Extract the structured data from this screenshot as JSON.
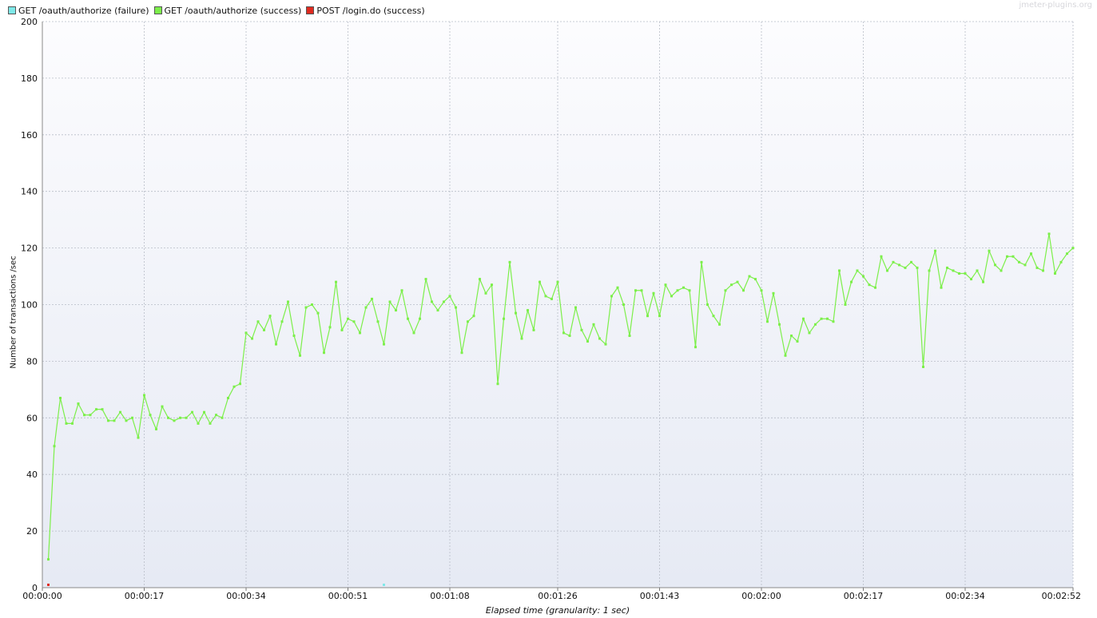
{
  "watermark": "jmeter-plugins.org",
  "legend": [
    {
      "label": "GET /oauth/authorize (failure)",
      "color": "#7ee8e8"
    },
    {
      "label": "GET /oauth/authorize (success)",
      "color": "#7cef4a"
    },
    {
      "label": "POST /login.do (success)",
      "color": "#e02b20"
    }
  ],
  "colors": {
    "plot_bg_top": "#fcfcfe",
    "plot_bg_bottom": "#e6eaf4",
    "grid": "#b8bdc8"
  },
  "chart_data": {
    "type": "line",
    "title": "",
    "xlabel": "Elapsed time (granularity: 1 sec)",
    "ylabel": "Number of transactions /sec",
    "ylim": [
      0,
      200
    ],
    "xlim": [
      0,
      172
    ],
    "x_unit": "seconds",
    "grid": true,
    "legend_position": "top-left",
    "yticks": [
      0,
      20,
      40,
      60,
      80,
      100,
      120,
      140,
      160,
      180,
      200
    ],
    "xticks": [
      {
        "value": 0,
        "label": "00:00:00"
      },
      {
        "value": 17,
        "label": "00:00:17"
      },
      {
        "value": 34,
        "label": "00:00:34"
      },
      {
        "value": 51,
        "label": "00:00:51"
      },
      {
        "value": 68,
        "label": "00:01:08"
      },
      {
        "value": 86,
        "label": "00:01:26"
      },
      {
        "value": 103,
        "label": "00:01:43"
      },
      {
        "value": 120,
        "label": "00:02:00"
      },
      {
        "value": 137,
        "label": "00:02:17"
      },
      {
        "value": 154,
        "label": "00:02:34"
      },
      {
        "value": 172,
        "label": "00:02:52"
      }
    ],
    "series": [
      {
        "name": "GET /oauth/authorize (failure)",
        "color": "#7ee8e8",
        "points": [
          [
            57,
            1
          ]
        ]
      },
      {
        "name": "GET /oauth/authorize (success)",
        "color": "#7cef4a",
        "points": [
          [
            1,
            10
          ],
          [
            2,
            50
          ],
          [
            3,
            67
          ],
          [
            4,
            58
          ],
          [
            5,
            58
          ],
          [
            6,
            65
          ],
          [
            7,
            61
          ],
          [
            8,
            61
          ],
          [
            9,
            63
          ],
          [
            10,
            63
          ],
          [
            11,
            59
          ],
          [
            12,
            59
          ],
          [
            13,
            62
          ],
          [
            14,
            59
          ],
          [
            15,
            60
          ],
          [
            16,
            53
          ],
          [
            17,
            68
          ],
          [
            18,
            61
          ],
          [
            19,
            56
          ],
          [
            20,
            64
          ],
          [
            21,
            60
          ],
          [
            22,
            59
          ],
          [
            23,
            60
          ],
          [
            24,
            60
          ],
          [
            25,
            62
          ],
          [
            26,
            58
          ],
          [
            27,
            62
          ],
          [
            28,
            58
          ],
          [
            29,
            61
          ],
          [
            30,
            60
          ],
          [
            31,
            67
          ],
          [
            32,
            71
          ],
          [
            33,
            72
          ],
          [
            34,
            90
          ],
          [
            35,
            88
          ],
          [
            36,
            94
          ],
          [
            37,
            91
          ],
          [
            38,
            96
          ],
          [
            39,
            86
          ],
          [
            40,
            94
          ],
          [
            41,
            101
          ],
          [
            42,
            89
          ],
          [
            43,
            82
          ],
          [
            44,
            99
          ],
          [
            45,
            100
          ],
          [
            46,
            97
          ],
          [
            47,
            83
          ],
          [
            48,
            92
          ],
          [
            49,
            108
          ],
          [
            50,
            91
          ],
          [
            51,
            95
          ],
          [
            52,
            94
          ],
          [
            53,
            90
          ],
          [
            54,
            99
          ],
          [
            55,
            102
          ],
          [
            56,
            94
          ],
          [
            57,
            86
          ],
          [
            58,
            101
          ],
          [
            59,
            98
          ],
          [
            60,
            105
          ],
          [
            61,
            95
          ],
          [
            62,
            90
          ],
          [
            63,
            95
          ],
          [
            64,
            109
          ],
          [
            65,
            101
          ],
          [
            66,
            98
          ],
          [
            67,
            101
          ],
          [
            68,
            103
          ],
          [
            69,
            99
          ],
          [
            70,
            83
          ],
          [
            71,
            94
          ],
          [
            72,
            96
          ],
          [
            73,
            109
          ],
          [
            74,
            104
          ],
          [
            75,
            107
          ],
          [
            76,
            72
          ],
          [
            77,
            95
          ],
          [
            78,
            115
          ],
          [
            79,
            97
          ],
          [
            80,
            88
          ],
          [
            81,
            98
          ],
          [
            82,
            91
          ],
          [
            83,
            108
          ],
          [
            84,
            103
          ],
          [
            85,
            102
          ],
          [
            86,
            108
          ],
          [
            87,
            90
          ],
          [
            88,
            89
          ],
          [
            89,
            99
          ],
          [
            90,
            91
          ],
          [
            91,
            87
          ],
          [
            92,
            93
          ],
          [
            93,
            88
          ],
          [
            94,
            86
          ],
          [
            95,
            103
          ],
          [
            96,
            106
          ],
          [
            97,
            100
          ],
          [
            98,
            89
          ],
          [
            99,
            105
          ],
          [
            100,
            105
          ],
          [
            101,
            96
          ],
          [
            102,
            104
          ],
          [
            103,
            96
          ],
          [
            104,
            107
          ],
          [
            105,
            103
          ],
          [
            106,
            105
          ],
          [
            107,
            106
          ],
          [
            108,
            105
          ],
          [
            109,
            85
          ],
          [
            110,
            115
          ],
          [
            111,
            100
          ],
          [
            112,
            96
          ],
          [
            113,
            93
          ],
          [
            114,
            105
          ],
          [
            115,
            107
          ],
          [
            116,
            108
          ],
          [
            117,
            105
          ],
          [
            118,
            110
          ],
          [
            119,
            109
          ],
          [
            120,
            105
          ],
          [
            121,
            94
          ],
          [
            122,
            104
          ],
          [
            123,
            93
          ],
          [
            124,
            82
          ],
          [
            125,
            89
          ],
          [
            126,
            87
          ],
          [
            127,
            95
          ],
          [
            128,
            90
          ],
          [
            129,
            93
          ],
          [
            130,
            95
          ],
          [
            131,
            95
          ],
          [
            132,
            94
          ],
          [
            133,
            112
          ],
          [
            134,
            100
          ],
          [
            135,
            108
          ],
          [
            136,
            112
          ],
          [
            137,
            110
          ],
          [
            138,
            107
          ],
          [
            139,
            106
          ],
          [
            140,
            117
          ],
          [
            141,
            112
          ],
          [
            142,
            115
          ],
          [
            143,
            114
          ],
          [
            144,
            113
          ],
          [
            145,
            115
          ],
          [
            146,
            113
          ],
          [
            147,
            78
          ],
          [
            148,
            112
          ],
          [
            149,
            119
          ],
          [
            150,
            106
          ],
          [
            151,
            113
          ],
          [
            152,
            112
          ],
          [
            153,
            111
          ],
          [
            154,
            111
          ],
          [
            155,
            109
          ],
          [
            156,
            112
          ],
          [
            157,
            108
          ],
          [
            158,
            119
          ],
          [
            159,
            114
          ],
          [
            160,
            112
          ],
          [
            161,
            117
          ],
          [
            162,
            117
          ],
          [
            163,
            115
          ],
          [
            164,
            114
          ],
          [
            165,
            118
          ],
          [
            166,
            113
          ],
          [
            167,
            112
          ],
          [
            168,
            125
          ],
          [
            169,
            111
          ],
          [
            170,
            115
          ],
          [
            171,
            118
          ],
          [
            172,
            120
          ]
        ]
      },
      {
        "name": "POST /login.do (success)",
        "color": "#e02b20",
        "points": [
          [
            1,
            1
          ]
        ]
      }
    ]
  }
}
